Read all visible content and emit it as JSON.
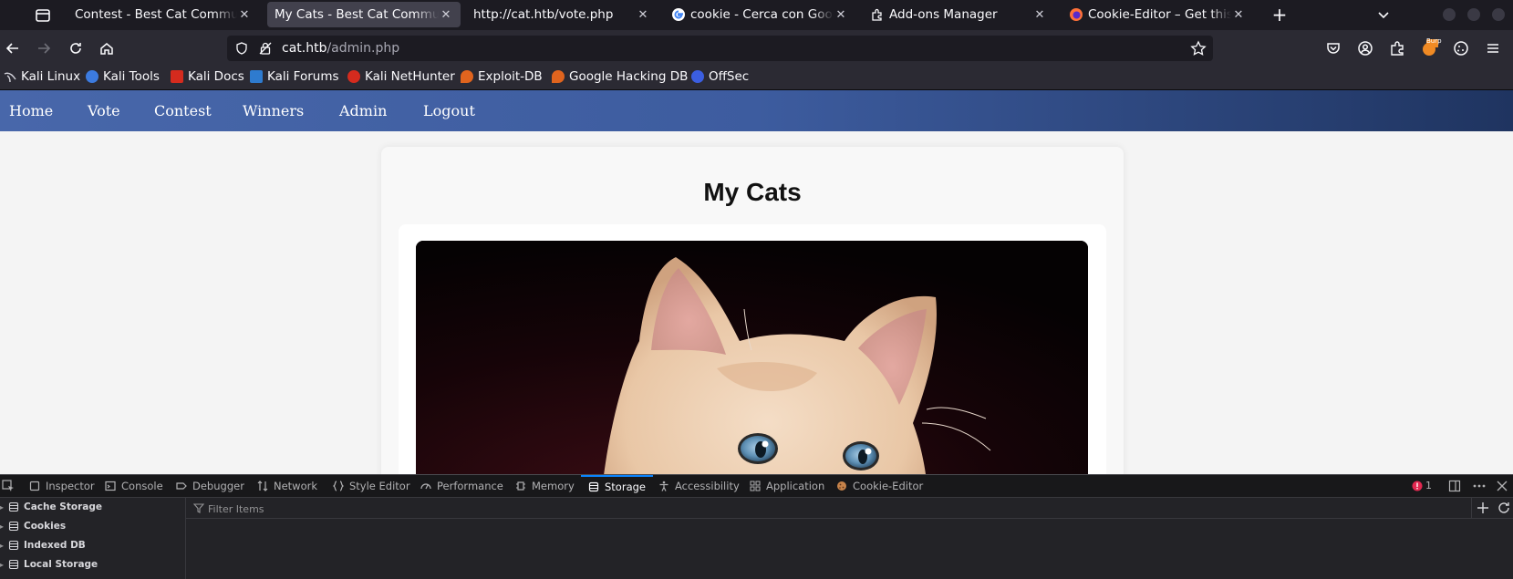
{
  "browser": {
    "tabs": [
      {
        "title": "Contest - Best Cat Communi",
        "active": false,
        "favicon": "none"
      },
      {
        "title": "My Cats - Best Cat Communi",
        "active": true,
        "favicon": "none"
      },
      {
        "title": "http://cat.htb/vote.php",
        "active": false,
        "favicon": "none"
      },
      {
        "title": "cookie - Cerca con Google",
        "active": false,
        "favicon": "google-icon"
      },
      {
        "title": "Add-ons Manager",
        "active": false,
        "favicon": "puzzle-icon"
      },
      {
        "title": "Cookie-Editor – Get this E",
        "active": false,
        "favicon": "firefox-icon"
      }
    ],
    "url": {
      "host": "cat.htb",
      "path": "/admin.php"
    },
    "bookmarks": [
      {
        "label": "Kali Linux",
        "icon": "kali-icon",
        "color": "#1d1d1d"
      },
      {
        "label": "Kali Tools",
        "icon": "kali-tools-icon",
        "color": "#3c7be0"
      },
      {
        "label": "Kali Docs",
        "icon": "kali-docs-icon",
        "color": "#d52b1e"
      },
      {
        "label": "Kali Forums",
        "icon": "kali-forums-icon",
        "color": "#2e7bcf"
      },
      {
        "label": "Kali NetHunter",
        "icon": "nethunter-icon",
        "color": "#d52b1e"
      },
      {
        "label": "Exploit-DB",
        "icon": "exploit-db-icon",
        "color": "#e0641e"
      },
      {
        "label": "Google Hacking DB",
        "icon": "ghdb-icon",
        "color": "#e0641e"
      },
      {
        "label": "OffSec",
        "icon": "offsec-icon",
        "color": "#3b5ee0"
      }
    ],
    "extension_badge": "Burp"
  },
  "site": {
    "nav": [
      "Home",
      "Vote",
      "Contest",
      "Winners",
      "Admin",
      "Logout"
    ],
    "page_title": "My Cats",
    "colors": {
      "nav_start": "#4867aa",
      "nav_end": "#1f3460"
    }
  },
  "devtools": {
    "tabs": [
      "Inspector",
      "Console",
      "Debugger",
      "Network",
      "Style Editor",
      "Performance",
      "Memory",
      "Storage",
      "Accessibility",
      "Application",
      "Cookie-Editor"
    ],
    "active_tab": "Storage",
    "error_count": "1",
    "storage_tree": [
      "Cache Storage",
      "Cookies",
      "Indexed DB",
      "Local Storage"
    ],
    "filter_placeholder": "Filter Items"
  }
}
